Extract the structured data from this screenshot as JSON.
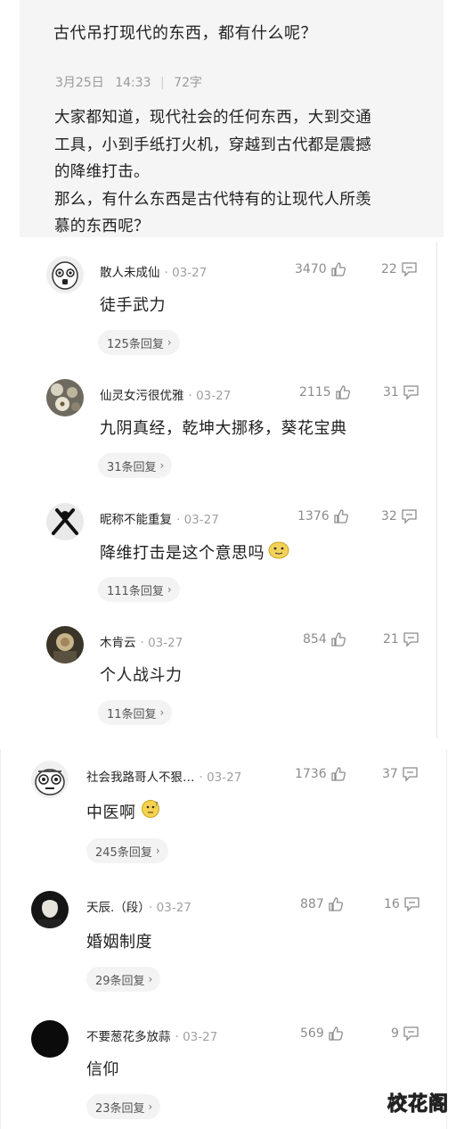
{
  "question": {
    "title": "古代吊打现代的东西，都有什么呢？",
    "date": "3月25日",
    "time": "14:33",
    "word_count": "72字",
    "body": [
      "大家都知道，现代社会的任何东西，大到交通",
      "工具，小到手纸打火机，穿越到古代都是震撼",
      "的降维打击。",
      "那么，有什么东西是古代特有的让现代人所羡",
      "慕的东西呢？"
    ]
  },
  "comments": [
    {
      "name": "散人未成仙",
      "date": "03-27",
      "likes": "3470",
      "replies": "22",
      "text": "徒手武力",
      "reply_label": "125条回复",
      "avatar": "ghost-avatar"
    },
    {
      "name": "仙灵女污很优雅",
      "date": "03-27",
      "likes": "2115",
      "replies": "31",
      "text": "九阴真经，乾坤大挪移，葵花宝典",
      "reply_label": "31条回复",
      "avatar": "flower-avatar"
    },
    {
      "name": "昵称不能重复",
      "date": "03-27",
      "likes": "1376",
      "replies": "32",
      "text": "降维打击是这个意思吗",
      "reply_label": "111条回复",
      "avatar": "figure-avatar",
      "emoji": "face-emoji"
    },
    {
      "name": "木肯云",
      "date": "03-27",
      "likes": "854",
      "replies": "21",
      "text": "个人战斗力",
      "reply_label": "11条回复",
      "avatar": "photo-avatar"
    },
    {
      "name": "社会我路哥人不狠…",
      "date": "03-27",
      "likes": "1736",
      "replies": "37",
      "text": "中医啊",
      "reply_label": "245条回复",
      "avatar": "cartoon-avatar",
      "emoji": "thinking-emoji"
    },
    {
      "name": "天辰.（段）",
      "date": "03-27",
      "likes": "887",
      "replies": "16",
      "text": "婚姻制度",
      "reply_label": "29条回复",
      "avatar": "dark-portrait-avatar"
    },
    {
      "name": "不要葱花多放蒜",
      "date": "03-27",
      "likes": "569",
      "replies": "9",
      "text": "信仰",
      "reply_label": "23条回复",
      "avatar": "black-avatar"
    }
  ],
  "watermark": "校花阁",
  "colors": {
    "card_bg": "#f5f5f5",
    "meta_gray": "#9a9a9a",
    "pill_bg": "#f3f3f3"
  }
}
